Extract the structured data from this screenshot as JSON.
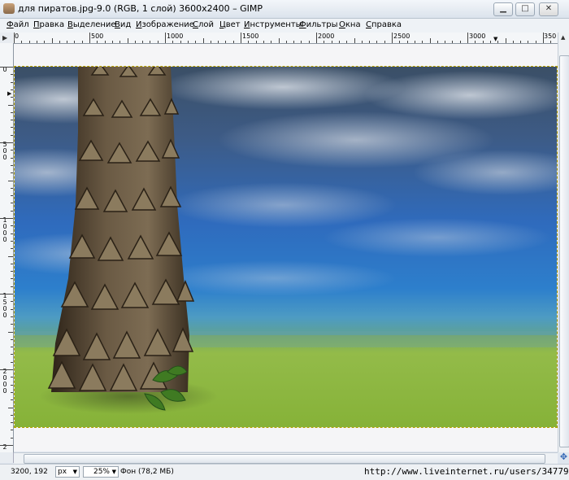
{
  "window": {
    "title": "для пиратов.jpg-9.0 (RGB, 1 слой) 3600x2400 – GIMP",
    "minimize": "▁",
    "maximize": "□",
    "close": "✕"
  },
  "menu": [
    "Файл",
    "Правка",
    "Выделение",
    "Вид",
    "Изображение",
    "Слой",
    "Цвет",
    "Инструменты",
    "Фильтры",
    "Окна",
    "Справка"
  ],
  "ruler": {
    "horizontal": [
      "0",
      "500",
      "1000",
      "1500",
      "2000",
      "2500",
      "3000",
      "350"
    ],
    "vertical": [
      "0",
      "500",
      "1000",
      "1500",
      "2000",
      "2"
    ]
  },
  "status": {
    "coordinates": "3200, 192",
    "unit": "px",
    "zoom": "25%",
    "layer": "Фон (78,2 МБ)",
    "watermark_url": "http://www.liveinternet.ru/users/3477996/"
  },
  "colors": {
    "sky_top": "#2b3d55",
    "sky_mid": "#2e66b4",
    "horizon": "#3a8fc9",
    "grass": "#8fb83c",
    "trunk": "#5a4a36"
  },
  "icons": {
    "navigate": "navigate-icon",
    "quickmask": "quickmask-icon"
  }
}
